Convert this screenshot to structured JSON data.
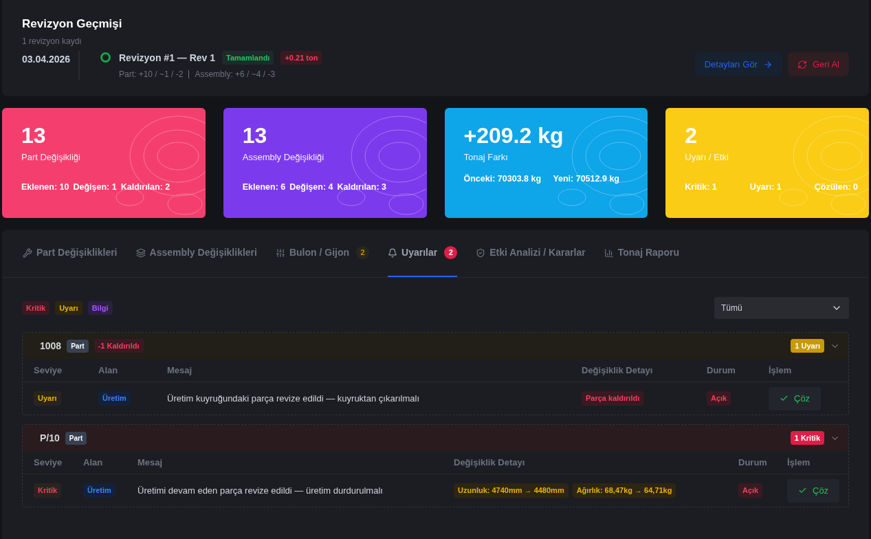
{
  "header": {
    "title": "Revizyon Geçmişi",
    "subtitle": "1 revizyon kaydı",
    "date": "03.04.2026",
    "revision": {
      "title": "Revizyon #1 — Rev 1",
      "status": "Tamamlandı",
      "delta": "+0.21 ton",
      "part_summary": "Part: +10 / ~1 / -2",
      "assembly_summary": "Assembly: +6 / ~4 / -3"
    },
    "buttons": [
      {
        "kind": "details",
        "label": "Detayları Gör"
      },
      {
        "kind": "undo",
        "label": "Geri Al"
      }
    ]
  },
  "stats": [
    {
      "kind": "pink",
      "value": "13",
      "label": "Part Değişikliği",
      "footer": [
        "Eklenen: 10",
        "Değişen: 1",
        "Kaldırılan: 2"
      ]
    },
    {
      "kind": "purple",
      "value": "13",
      "label": "Assembly Değişikliği",
      "footer": [
        "Eklenen: 6",
        "Değişen: 4",
        "Kaldırılan: 3"
      ]
    },
    {
      "kind": "blue",
      "value": "+209.2 kg",
      "label": "Tonaj Farkı",
      "footer": [
        "Önceki: 70303.8 kg",
        "Yeni: 70512.9 kg"
      ]
    },
    {
      "kind": "yellow",
      "value": "2",
      "label": "Uyarı / Etki",
      "footer": [
        "Kritik: 1",
        "Uyarı: 1",
        "Çözülen: 0"
      ]
    }
  ],
  "tabs": [
    {
      "label": "Part Değişiklikleri",
      "selected": false
    },
    {
      "label": "Assembly Değişiklikleri",
      "selected": false
    },
    {
      "label": "Bulon / Gijon",
      "badge": "2",
      "selected": false
    },
    {
      "label": "Uyarılar",
      "badge": "2",
      "selected": true
    },
    {
      "label": "Etki Analizi / Kararlar",
      "selected": false
    },
    {
      "label": "Tonaj Raporu",
      "selected": false
    }
  ],
  "filters": [
    {
      "kind": "red",
      "label": "Kritik"
    },
    {
      "kind": "yellow",
      "label": "Uyarı"
    },
    {
      "kind": "purple",
      "label": "Bilgi"
    }
  ],
  "filter_select": {
    "value": "Tümü"
  },
  "groups": [
    {
      "kind": "warning",
      "name": "1008",
      "type": "Part",
      "change": "-1 Kaldırıldı",
      "count": "1 Uyarı",
      "columns": [
        "Seviye",
        "Alan",
        "Mesaj",
        "Değişiklik Detayı",
        "Durum",
        "İşlem"
      ],
      "rows": [
        {
          "level": {
            "text": "Uyarı",
            "color": "#eab308"
          },
          "area": "Üretim",
          "message": "Üretim kuyruğundaki parça revize edildi — kuyruktan çıkarılmalı",
          "details": [
            {
              "kind": "red",
              "text": "Parça kaldırıldı"
            }
          ],
          "status": "Açık",
          "action": "Çöz"
        }
      ]
    },
    {
      "kind": "critical",
      "name": "P/10",
      "type": "Part",
      "count": "1 Kritik",
      "columns": [
        "Seviye",
        "Alan",
        "Mesaj",
        "Değişiklik Detayı",
        "Durum",
        "İşlem"
      ],
      "rows": [
        {
          "level": {
            "text": "Kritik",
            "color": "#f43f5e"
          },
          "area": "Üretim",
          "message": "Üretimi devam eden parça revize edildi — üretim durdurulmalı",
          "details": [
            {
              "kind": "yellow",
              "text": "Uzunluk: 4740mm → 4480mm"
            },
            {
              "kind": "yellow",
              "text": "Ağırlık: 68,47kg → 64,71kg"
            }
          ],
          "status": "Açık",
          "action": "Çöz"
        }
      ]
    }
  ]
}
